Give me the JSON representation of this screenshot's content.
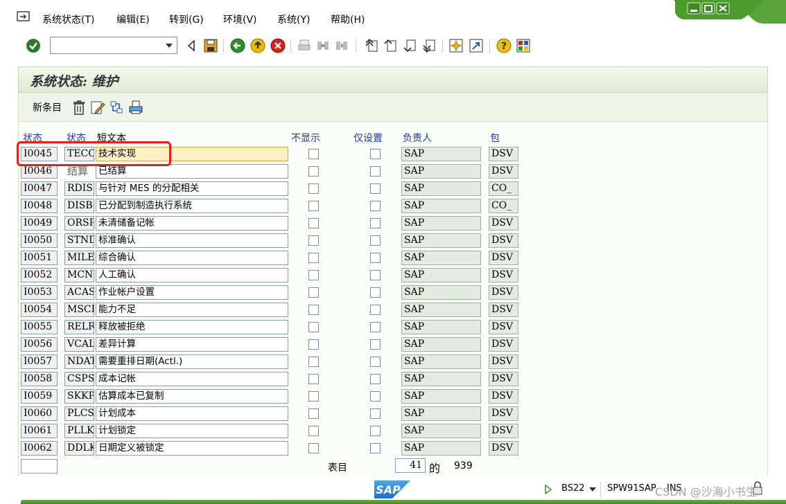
{
  "menu": {
    "items": [
      "系统状态(T)",
      "编辑(E)",
      "转到(G)",
      "环境(V)",
      "系统(Y)",
      "帮助(H)"
    ]
  },
  "toolbar": {
    "command_value": "",
    "icons": [
      "enter-check-icon",
      "command-dropdown-icon",
      "back-arrow-icon",
      "save-icon",
      "back-icon",
      "exit-icon",
      "cancel-icon",
      "print-icon",
      "find-icon",
      "find-next-icon",
      "first-page-icon",
      "prev-page-icon",
      "next-page-icon",
      "last-page-icon",
      "new-session-icon",
      "create-shortcut-icon",
      "help-icon",
      "layout-menu-icon"
    ]
  },
  "screen": {
    "title": "系统状态: 维护",
    "app_toolbar": {
      "new_entries": "新条目"
    }
  },
  "table": {
    "headers": [
      "状态",
      "状态",
      "短文本",
      "不显示",
      "仅设置",
      "负责人",
      "包"
    ],
    "rows": [
      {
        "status": "I0045",
        "code": "TECO",
        "text": "技术实现",
        "resp": "SAP",
        "pkg": "DSV"
      },
      {
        "status": "I0046",
        "code": "结算",
        "text": "已结算",
        "resp": "SAP",
        "pkg": "DSV"
      },
      {
        "status": "I0047",
        "code": "RDIS",
        "text": "与针对 MES 的分配相关",
        "resp": "SAP",
        "pkg": "CO_"
      },
      {
        "status": "I0048",
        "code": "DISB",
        "text": "已分配到制造执行系统",
        "resp": "SAP",
        "pkg": "CO_"
      },
      {
        "status": "I0049",
        "code": "ORSP",
        "text": "未清储备记帐",
        "resp": "SAP",
        "pkg": "DSV"
      },
      {
        "status": "I0050",
        "code": "STND",
        "text": "标准确认",
        "resp": "SAP",
        "pkg": "DSV"
      },
      {
        "status": "I0051",
        "code": "MILE",
        "text": "综合确认",
        "resp": "SAP",
        "pkg": "DSV"
      },
      {
        "status": "I0052",
        "code": "MCNF",
        "text": "人工确认",
        "resp": "SAP",
        "pkg": "DSV"
      },
      {
        "status": "I0053",
        "code": "ACAS",
        "text": "作业帐户设置",
        "resp": "SAP",
        "pkg": "DSV"
      },
      {
        "status": "I0054",
        "code": "MSCP",
        "text": "能力不足",
        "resp": "SAP",
        "pkg": "DSV"
      },
      {
        "status": "I0055",
        "code": "RELR",
        "text": "释放被拒绝",
        "resp": "SAP",
        "pkg": "DSV"
      },
      {
        "status": "I0056",
        "code": "VCAL",
        "text": "差异计算",
        "resp": "SAP",
        "pkg": "DSV"
      },
      {
        "status": "I0057",
        "code": "NDAT",
        "text": "需要重排日期(Actl.)",
        "resp": "SAP",
        "pkg": "DSV"
      },
      {
        "status": "I0058",
        "code": "CSPS",
        "text": "成本记帐",
        "resp": "SAP",
        "pkg": "DSV"
      },
      {
        "status": "I0059",
        "code": "SKKP",
        "text": "估算成本已复制",
        "resp": "SAP",
        "pkg": "DSV"
      },
      {
        "status": "I0060",
        "code": "PLCS",
        "text": "计划成本",
        "resp": "SAP",
        "pkg": "DSV"
      },
      {
        "status": "I0061",
        "code": "PLLK",
        "text": "计划锁定",
        "resp": "SAP",
        "pkg": "DSV"
      },
      {
        "status": "I0062",
        "code": "DDLK",
        "text": "日期定义被锁定",
        "resp": "SAP",
        "pkg": "DSV"
      }
    ],
    "footer": {
      "entry_label": "表目",
      "current": "41",
      "of_label": "的",
      "total": "939"
    }
  },
  "statusbar": {
    "logo": "SAP",
    "transaction": "BS22",
    "system": "SPW91SAP",
    "mode": "INS",
    "watermark": "CSDN @沙海小书生"
  },
  "colors": {
    "title_bg": "#dfead2",
    "header_text": "#1c3aa9",
    "highlight": "#e8201c",
    "sap_blue": "#1a6fc9",
    "green": "#4a9a2b"
  }
}
